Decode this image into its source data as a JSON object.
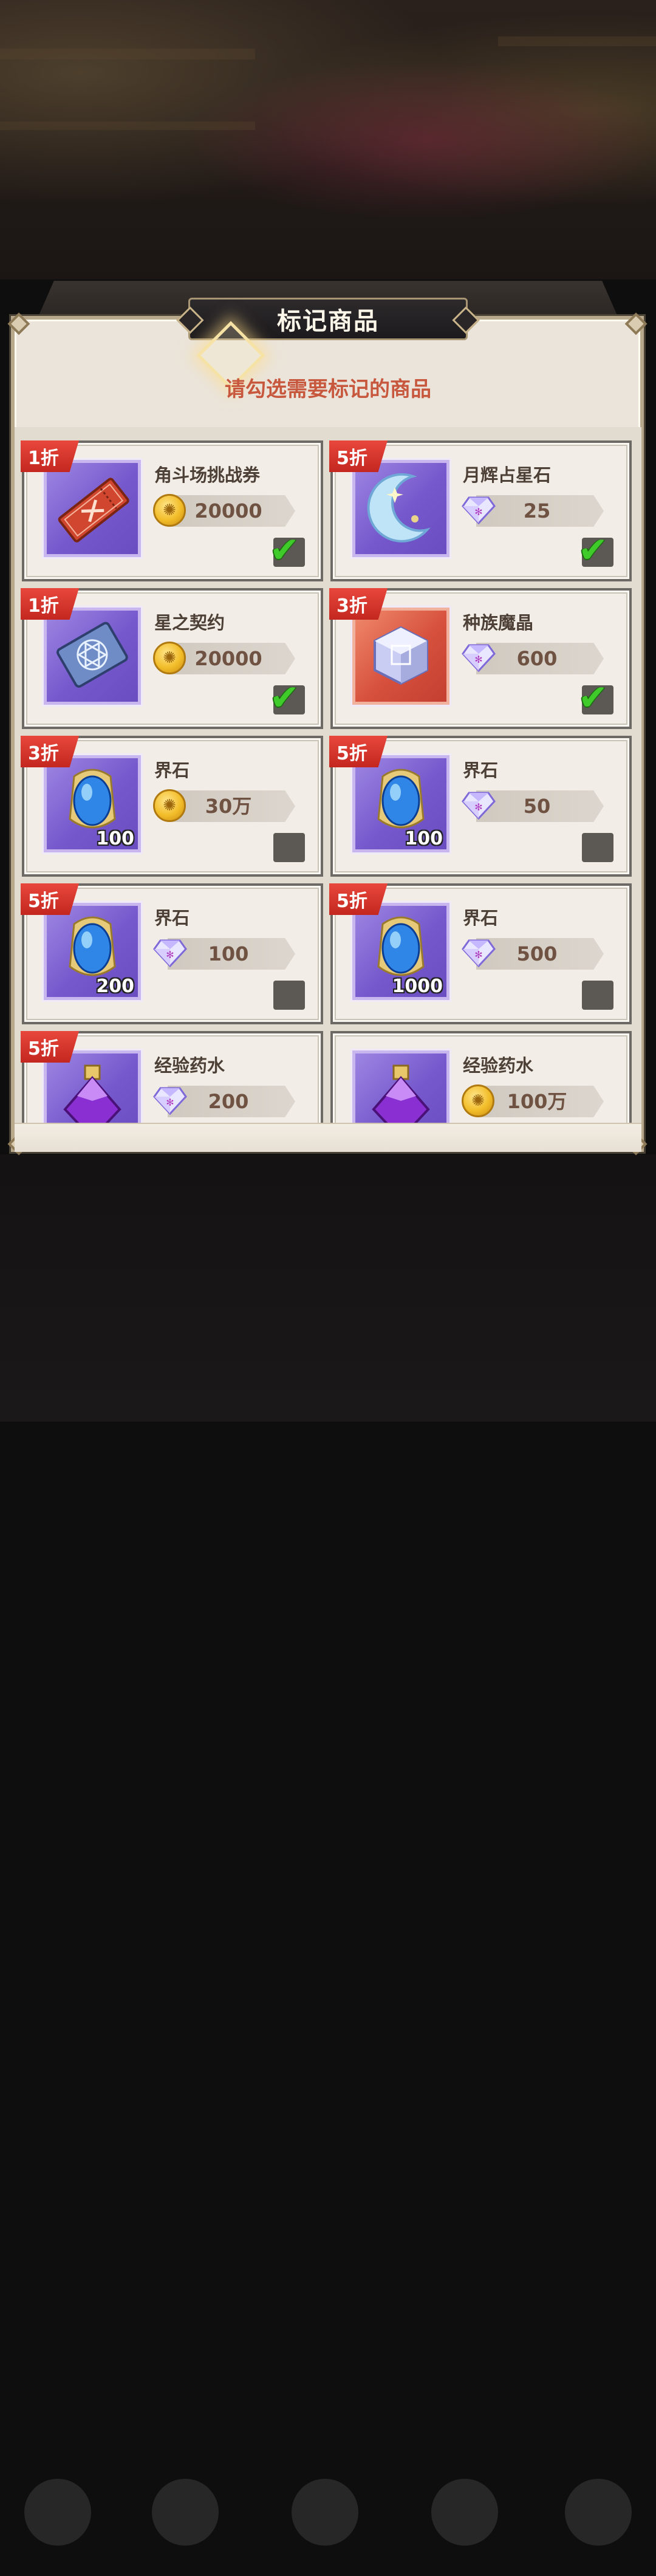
{
  "dialog": {
    "title": "标记商品",
    "subtitle": "请勾选需要标记的商品"
  },
  "items": [
    {
      "badge": "1折",
      "name": "角斗场挑战券",
      "currency": "coin",
      "price": "20000",
      "quantity": "",
      "icon": "ticket-icon",
      "checked": true
    },
    {
      "badge": "5折",
      "name": "月辉占星石",
      "currency": "diamond",
      "price": "25",
      "quantity": "",
      "icon": "crescent-moon-icon",
      "checked": true
    },
    {
      "badge": "1折",
      "name": "星之契约",
      "currency": "coin",
      "price": "20000",
      "quantity": "",
      "icon": "star-contract-book-icon",
      "checked": true
    },
    {
      "badge": "3折",
      "name": "种族魔晶",
      "currency": "diamond",
      "price": "600",
      "quantity": "",
      "icon": "crystal-cube-icon",
      "checked": true
    },
    {
      "badge": "3折",
      "name": "界石",
      "currency": "coin",
      "price": "30万",
      "quantity": "100",
      "icon": "blue-stone-icon",
      "checked": false
    },
    {
      "badge": "5折",
      "name": "界石",
      "currency": "diamond",
      "price": "50",
      "quantity": "100",
      "icon": "blue-stone-icon",
      "checked": false
    },
    {
      "badge": "5折",
      "name": "界石",
      "currency": "diamond",
      "price": "100",
      "quantity": "200",
      "icon": "blue-stone-icon",
      "checked": false
    },
    {
      "badge": "5折",
      "name": "界石",
      "currency": "diamond",
      "price": "500",
      "quantity": "1000",
      "icon": "blue-stone-icon",
      "checked": false
    },
    {
      "badge": "5折",
      "name": "经验药水",
      "currency": "diamond",
      "price": "200",
      "quantity": "",
      "icon": "potion-icon",
      "checked": false
    },
    {
      "badge": "",
      "name": "经验药水",
      "currency": "coin",
      "price": "100万",
      "quantity": "",
      "icon": "potion-icon",
      "checked": false
    }
  ],
  "colors": {
    "badge": "#d8342a",
    "check": "#3fcc2a",
    "price_text": "#6f5242",
    "subtitle": "#c7573d"
  }
}
